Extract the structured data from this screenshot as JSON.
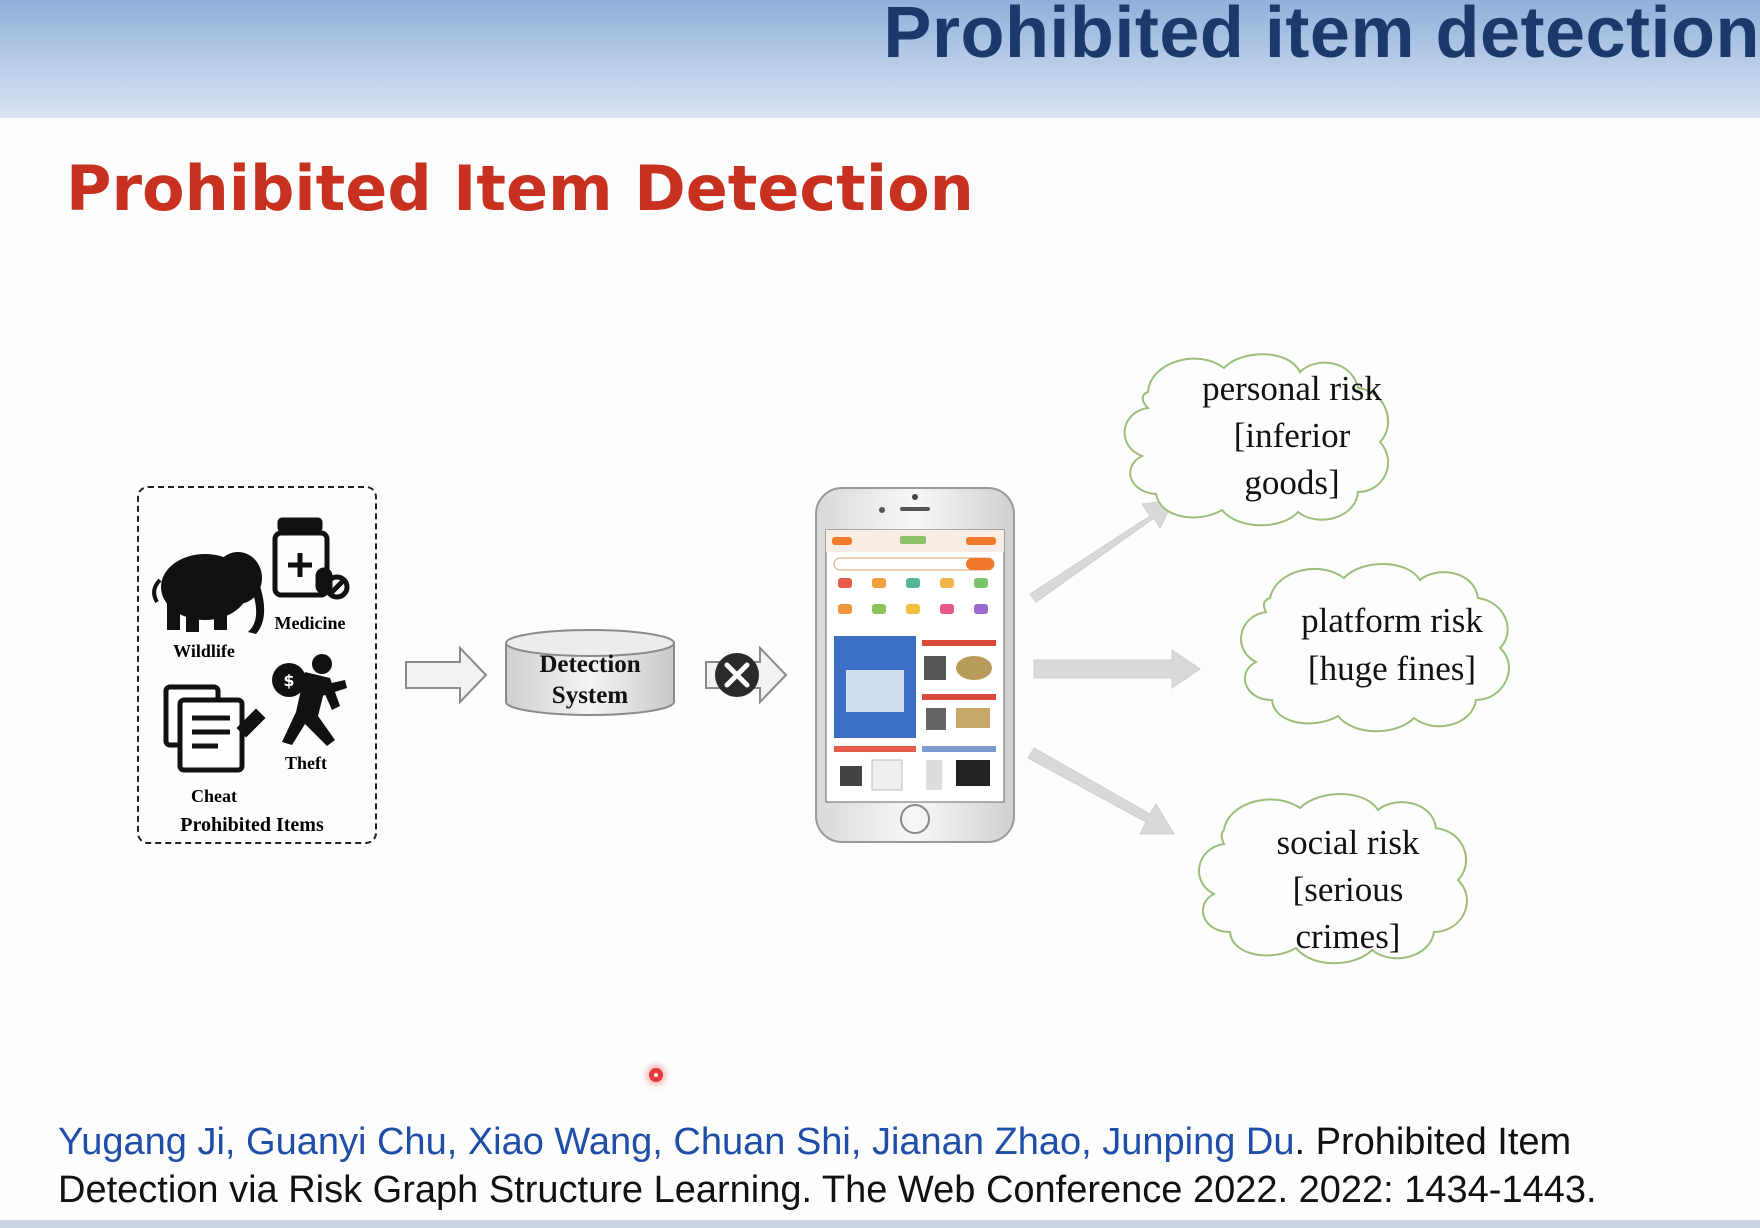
{
  "banner": {
    "title": "Prohibited item detection"
  },
  "slide": {
    "title": "Prohibited Item Detection"
  },
  "diagram": {
    "prohibited_items": {
      "caption": "Prohibited Items",
      "labels": {
        "wildlife": "Wildlife",
        "medicine": "Medicine",
        "cheat": "Cheat",
        "theft": "Theft"
      }
    },
    "detection_system": {
      "line1": "Detection",
      "line2": "System"
    },
    "risks": {
      "personal": {
        "line1": "personal risk",
        "line2": "[inferior",
        "line3": "goods]"
      },
      "platform": {
        "line1": "platform risk",
        "line2": "[huge fines]"
      },
      "social": {
        "line1": "social risk",
        "line2": "[serious",
        "line3": "crimes]"
      }
    }
  },
  "citation": {
    "authors": "Yugang Ji, Guanyi Chu, Xiao Wang, Chuan Shi, Jianan Zhao, Junping Du",
    "rest": ". Prohibited Item Detection via Risk Graph Structure Learning. The Web Conference 2022. 2022: 1434-1443."
  },
  "colors": {
    "banner_title": "#1b3a6b",
    "slide_title": "#c8311f",
    "authors": "#1f4ea8",
    "cloud_stroke": "#9bbf7a"
  }
}
